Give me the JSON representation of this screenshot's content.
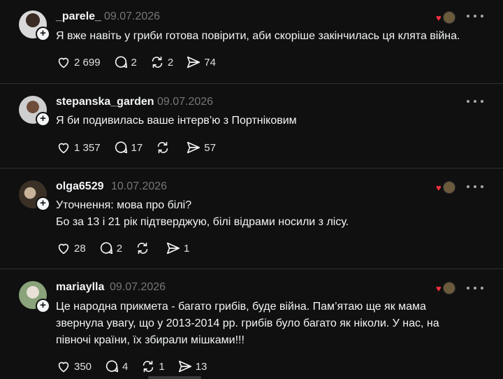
{
  "posts": [
    {
      "username": "_parele_",
      "date": "09.07.2026",
      "lines": [
        "Я вже навіть у гриби готова повірити, аби скоріше закінчилась ця клята війна."
      ],
      "likes": "2 699",
      "replies": "2",
      "reposts": "2",
      "shares": "74",
      "has_reactions": true
    },
    {
      "username": "stepanska_garden",
      "date": "09.07.2026",
      "lines": [
        "Я би подивилась ваше інтерв’ю з Портніковим"
      ],
      "likes": "1 357",
      "replies": "17",
      "reposts": "",
      "shares": "57",
      "has_reactions": false
    },
    {
      "username": "olga6529",
      "date": "10.07.2026",
      "lines": [
        "Уточнення: мова про білі?",
        "Бо за 13 і 21 рік підтверджую, білі відрами носили з лісу."
      ],
      "likes": "28",
      "replies": "2",
      "reposts": "",
      "shares": "1",
      "has_reactions": true
    },
    {
      "username": "mariaylla",
      "date": "09.07.2026",
      "lines": [
        "Це народна прикмета - багато грибів, буде війна. Пам’ятаю ще як мама",
        "звернула увагу, що у 2013-2014 рр. грибів було багато як ніколи. У нас, на",
        "півночі країни, їх збирали мішками!!!"
      ],
      "likes": "350",
      "replies": "4",
      "reposts": "1",
      "shares": "13",
      "has_reactions": true
    }
  ],
  "icons": {
    "like": "heart-icon",
    "reply": "comment-icon",
    "repost": "repost-icon",
    "share": "share-icon",
    "more": "more-icon",
    "follow": "plus-icon"
  },
  "colors": {
    "background": "#101010",
    "text": "#f3f5f7",
    "muted": "#777777",
    "heart": "#ff3040"
  }
}
